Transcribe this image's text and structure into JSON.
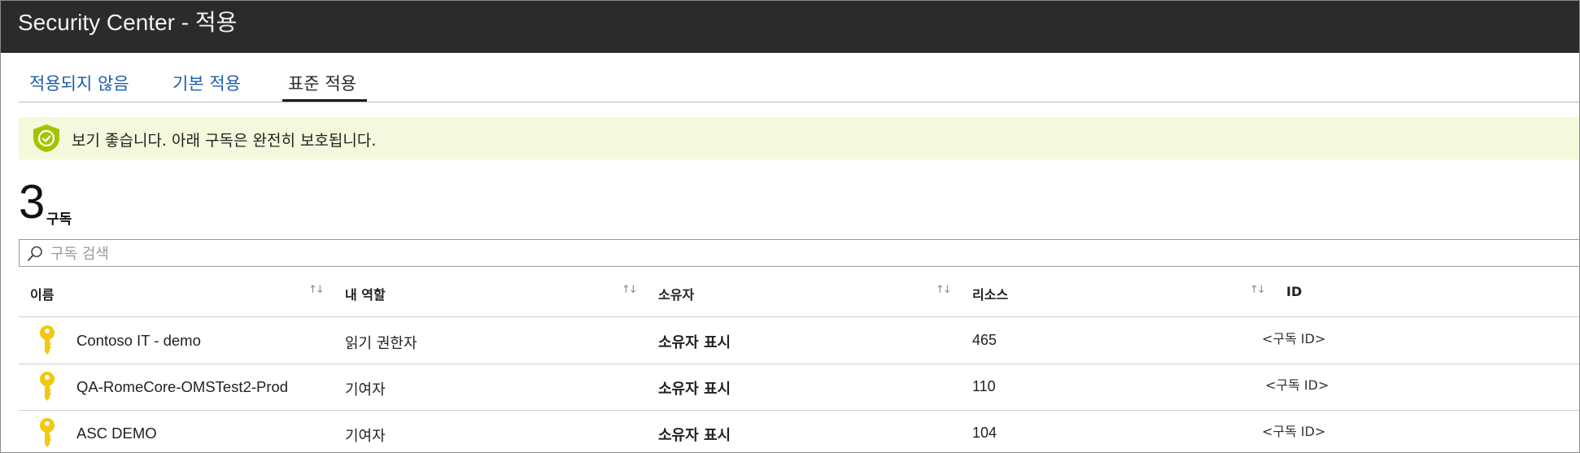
{
  "window": {
    "title": "Security Center - 적용"
  },
  "tabs": [
    {
      "label": "적용되지 않음",
      "active": false
    },
    {
      "label": "기본 적용",
      "active": false
    },
    {
      "label": "표준 적용",
      "active": true
    }
  ],
  "banner": {
    "message": "보기 좋습니다. 아래 구독은 완전히 보호됩니다.",
    "icon": "shield-check-icon",
    "color": "#a4c400"
  },
  "summary": {
    "count": "3",
    "label": "구독"
  },
  "search": {
    "placeholder": "구독 검색",
    "value": ""
  },
  "table": {
    "columns": [
      {
        "label": "이름",
        "sort": "↑↓"
      },
      {
        "label": "내 역할",
        "sort": "↑↓"
      },
      {
        "label": "소유자",
        "sort": "↑↓"
      },
      {
        "label": "리소스",
        "sort": "↑↓"
      },
      {
        "label": "ID"
      }
    ],
    "rows": [
      {
        "name": "Contoso IT - demo",
        "role": "읽기 권한자",
        "owner": "소유자 표시",
        "resources": "465",
        "id": "<구독 ID>",
        "icon": "key-icon"
      },
      {
        "name": "QA-RomeCore-OMSTest2-Prod",
        "role": "기여자",
        "owner": "소유자 표시",
        "resources": "110",
        "id": "<구독 ID>",
        "icon": "key-icon"
      },
      {
        "name": "ASC DEMO",
        "role": "기여자",
        "owner": "소유자 표시",
        "resources": "104",
        "id": "<구독 ID>",
        "icon": "key-icon"
      }
    ]
  },
  "colors": {
    "titlebar": "#2b2b2b",
    "link": "#1d5fa8",
    "banner_bg": "#f4f8dc",
    "key": "#f2c811"
  }
}
